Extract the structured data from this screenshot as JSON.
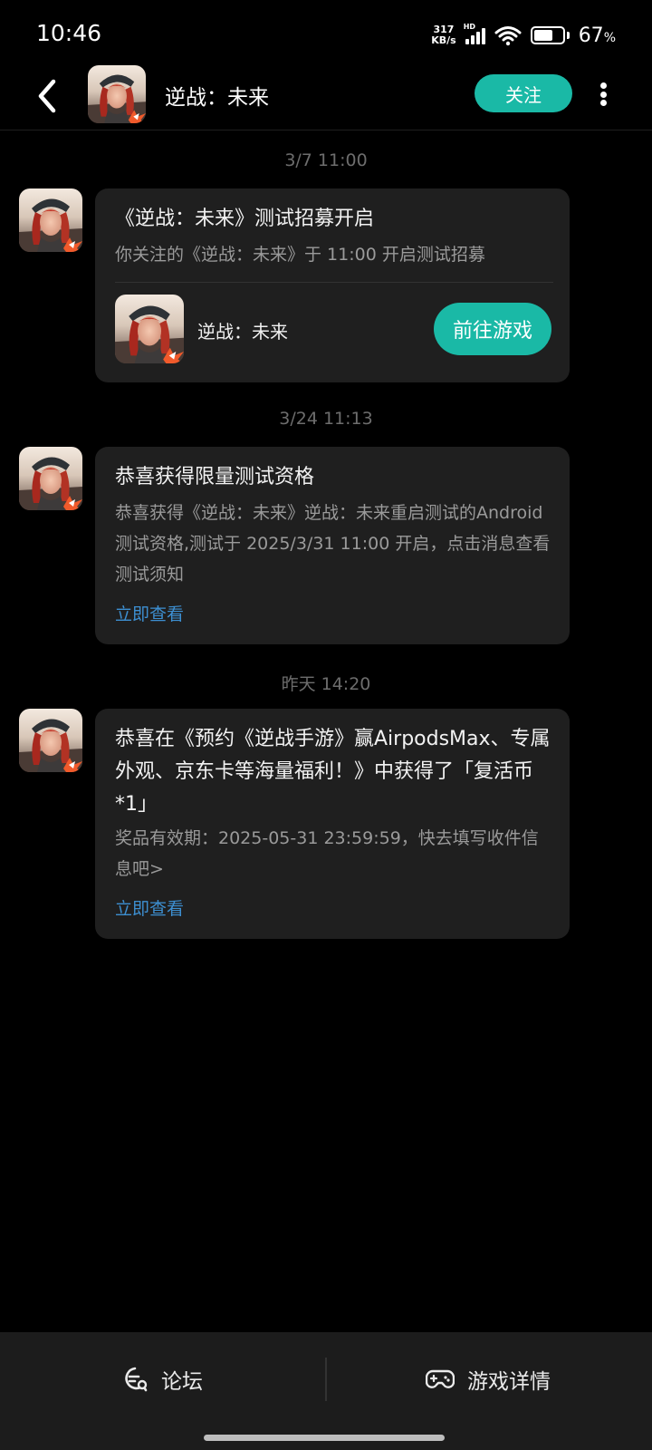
{
  "status_bar": {
    "time": "10:46",
    "net_speed_value": "317",
    "net_speed_unit": "KB/s",
    "signal_label": "HD",
    "battery_percent": "67",
    "battery_percent_sign": "%",
    "battery_level": 0.67
  },
  "header": {
    "title": "逆战：未来",
    "follow_label": "关注",
    "back_icon": "chevron-left-icon",
    "more_icon": "more-vertical-icon"
  },
  "messages": [
    {
      "time": "3/7  11:00",
      "title": "《逆战：未来》测试招募开启",
      "body": "你关注的《逆战：未来》于 11:00 开启测试招募",
      "game_name": "逆战：未来",
      "button_label": "前往游戏"
    },
    {
      "time": "3/24  11:13",
      "title": "恭喜获得限量测试资格",
      "body": "恭喜获得《逆战：未来》逆战：未来重启测试的Android测试资格,测试于 2025/3/31 11:00 开启，点击消息查看测试须知",
      "link_label": "立即查看"
    },
    {
      "time": "昨天  14:20",
      "title": "恭喜在《预约《逆战手游》赢AirpodsMax、专属外观、京东卡等海量福利！》中获得了「复活币*1」",
      "body": "奖品有效期：2025-05-31 23:59:59，快去填写收件信息吧>",
      "link_label": "立即查看"
    }
  ],
  "bottom_nav": {
    "forum_label": "论坛",
    "forum_icon": "forum-chat-icon",
    "details_label": "游戏详情",
    "details_icon": "gamepad-icon"
  },
  "colors": {
    "accent": "#1ab9a6",
    "link": "#3d8fd1",
    "card_bg": "#1f1f1f",
    "background": "#000000"
  }
}
